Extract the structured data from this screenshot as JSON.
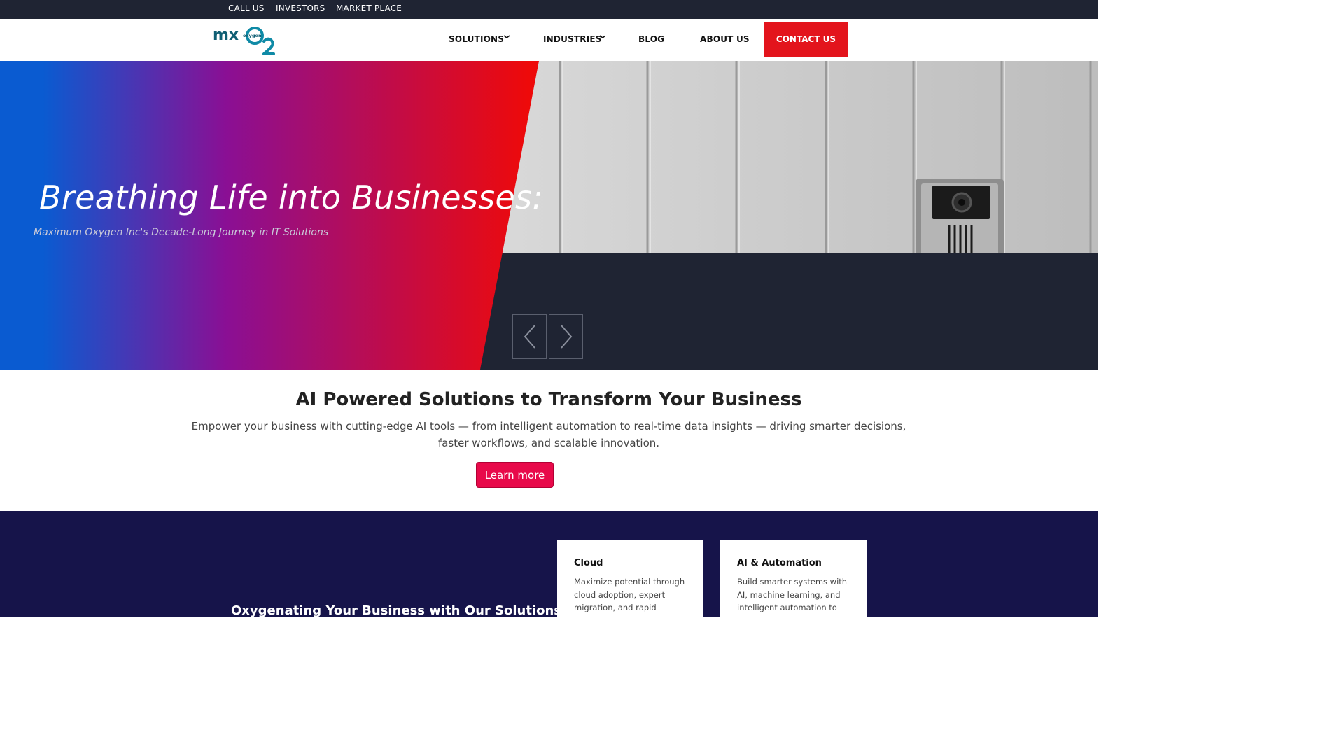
{
  "topbar": {
    "links": [
      "CALL US",
      "INVESTORS",
      "MARKET PLACE"
    ]
  },
  "header": {
    "logo": {
      "text": "mx",
      "sub": "oxygen",
      "mark": "O2"
    },
    "nav": {
      "solutions": "SOLUTIONS",
      "industries": "INDUSTRIES",
      "blog": "BLOG",
      "about": "ABOUT US",
      "contact": "CONTACT US"
    }
  },
  "hero": {
    "title": "Breathing Life into Businesses:",
    "subtitle": "Maximum Oxygen Inc's Decade-Long Journey in IT Solutions",
    "prev_icon": "chevron-left-icon",
    "next_icon": "chevron-right-icon"
  },
  "ai_section": {
    "title": "AI Powered Solutions to Transform Your Business",
    "description": "Empower your business with cutting-edge AI tools — from intelligent automation to real-time data insights — driving smarter decisions, faster workflows, and scalable innovation.",
    "button": "Learn more"
  },
  "solutions_section": {
    "title": "Oxygenating Your Business with Our Solutions",
    "cards": [
      {
        "title": "Cloud",
        "text": "Maximize potential through cloud adoption, expert migration, and rapid innovation."
      },
      {
        "title": "AI & Automation",
        "text": "Build smarter systems with AI, machine learning, and intelligent automation to streamline operations."
      }
    ]
  },
  "colors": {
    "topbar": "#1f2433",
    "contact": "#e3141c",
    "learn_more": "#e80a4a",
    "solutions_bg": "#16144a",
    "logo": "#0f5e73",
    "logo_accent": "#0f8aa6"
  }
}
